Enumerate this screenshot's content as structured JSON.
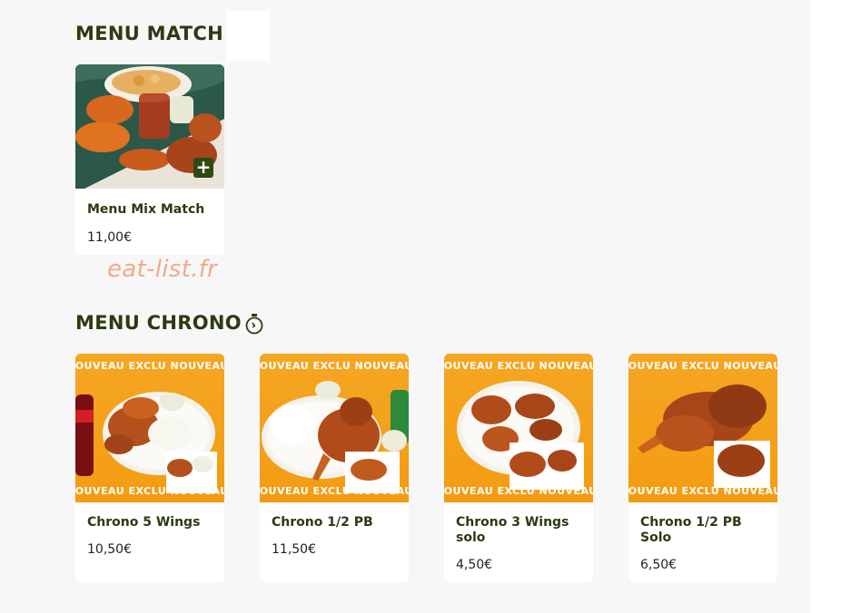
{
  "sections": {
    "match": {
      "title": "MENU MATCH",
      "items": [
        {
          "name": "Menu Mix Match",
          "price": "11,00€",
          "add_label": "+"
        }
      ]
    },
    "chrono": {
      "title": "MENU CHRONO",
      "icon": "stopwatch-icon",
      "items": [
        {
          "name": "Chrono 5 Wings",
          "price": "10,50€",
          "banner": "NOUVEAU EXCLU NOUVEAU"
        },
        {
          "name": "Chrono 1/2 PB",
          "price": "11,50€",
          "banner": "NOUVEAU EXCLU NOUVEAU"
        },
        {
          "name": "Chrono 3 Wings solo",
          "price": "4,50€",
          "banner": "NOUVEAU EXCLU NOUVEAU"
        },
        {
          "name": "Chrono 1/2 PB Solo",
          "price": "6,50€",
          "banner": "NOUVEAU EXCLU NOUVEAU"
        }
      ]
    }
  },
  "watermark": "eat-list.fr",
  "colors": {
    "title": "#2c3b12",
    "accent_orange": "#f5a623",
    "add_button": "#2f4a12",
    "watermark": "#f2a98a"
  }
}
